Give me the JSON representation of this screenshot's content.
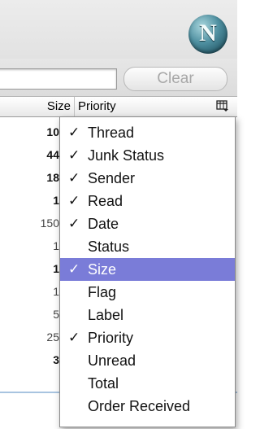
{
  "toolbar": {
    "logo_letter": "N"
  },
  "search": {
    "value": "",
    "clear_label": "Clear"
  },
  "columns": {
    "size_label": "Size",
    "priority_label": "Priority"
  },
  "rows": [
    {
      "size": "10",
      "bold": true
    },
    {
      "size": "44",
      "bold": true
    },
    {
      "size": "18",
      "bold": true
    },
    {
      "size": "1",
      "bold": true
    },
    {
      "size": "150",
      "bold": false
    },
    {
      "size": "1",
      "bold": false
    },
    {
      "size": "1",
      "bold": true
    },
    {
      "size": "1",
      "bold": false
    },
    {
      "size": "5",
      "bold": false
    },
    {
      "size": "25",
      "bold": false
    },
    {
      "size": "3",
      "bold": true
    }
  ],
  "menu": {
    "items": [
      {
        "label": "Thread",
        "checked": true,
        "selected": false
      },
      {
        "label": "Junk Status",
        "checked": true,
        "selected": false
      },
      {
        "label": "Sender",
        "checked": true,
        "selected": false
      },
      {
        "label": "Read",
        "checked": true,
        "selected": false
      },
      {
        "label": "Date",
        "checked": true,
        "selected": false
      },
      {
        "label": "Status",
        "checked": false,
        "selected": false
      },
      {
        "label": "Size",
        "checked": true,
        "selected": true
      },
      {
        "label": "Flag",
        "checked": false,
        "selected": false
      },
      {
        "label": "Label",
        "checked": false,
        "selected": false
      },
      {
        "label": "Priority",
        "checked": true,
        "selected": false
      },
      {
        "label": "Unread",
        "checked": false,
        "selected": false
      },
      {
        "label": "Total",
        "checked": false,
        "selected": false
      },
      {
        "label": "Order Received",
        "checked": false,
        "selected": false
      }
    ],
    "check_glyph": "✓",
    "highlight_color": "#7a7cd8"
  }
}
